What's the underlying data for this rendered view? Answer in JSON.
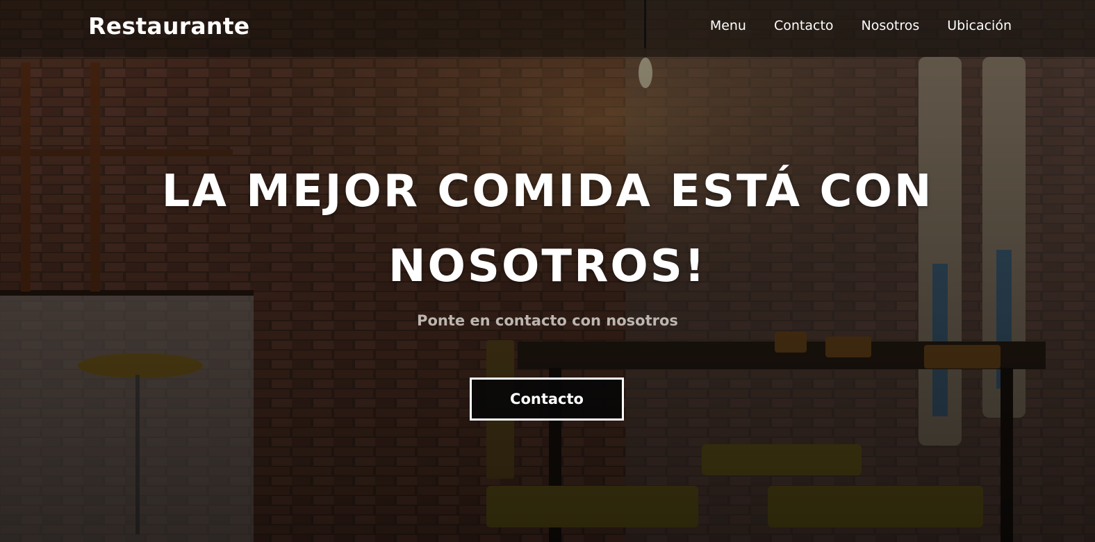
{
  "nav": {
    "brand": "Restaurante",
    "links": [
      "Menu",
      "Contacto",
      "Nosotros",
      "Ubicación"
    ]
  },
  "hero": {
    "headline": "LA MEJOR COMIDA ESTÁ CON NOSOTROS!",
    "subtitle": "Ponte en contacto con nosotros",
    "cta_label": "Contacto"
  },
  "colors": {
    "overlay": "#000000",
    "text": "#ffffff",
    "subtitle": "#bdb6b0",
    "button_bg": "#080808",
    "button_border": "#ffffff"
  },
  "background": {
    "icon": "restaurant-interior-photo"
  }
}
